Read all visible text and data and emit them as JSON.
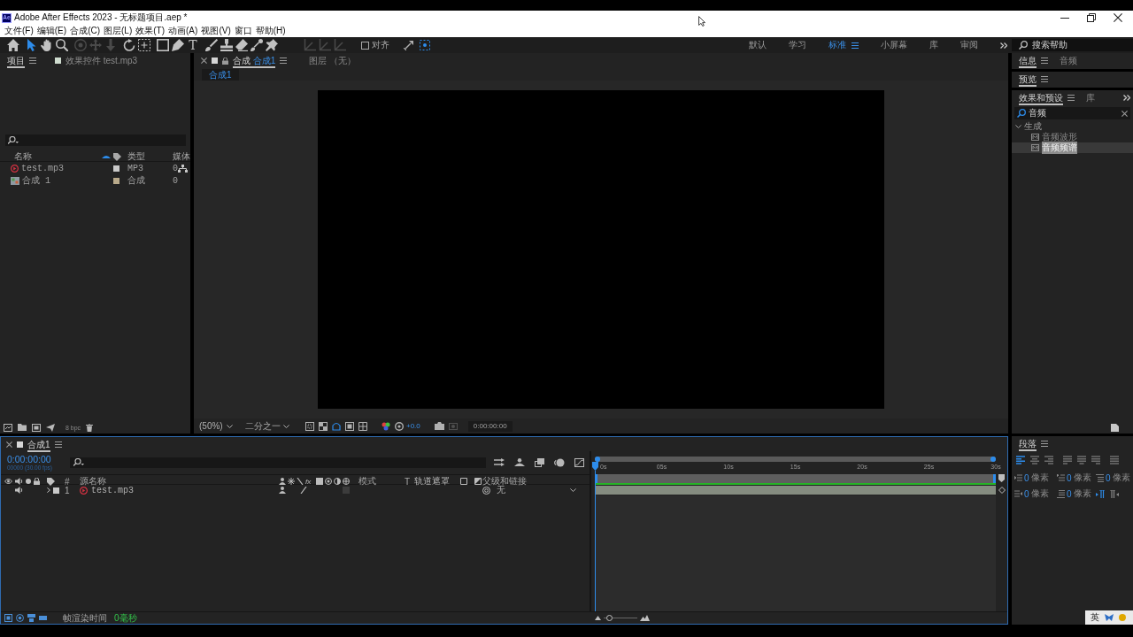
{
  "title_bar": {
    "logo": "Ae",
    "title": "Adobe After Effects 2023 - 无标题项目.aep *"
  },
  "menu_bar": [
    "文件(F)",
    "编辑(E)",
    "合成(C)",
    "图层(L)",
    "效果(T)",
    "动画(A)",
    "视图(V)",
    "窗口",
    "帮助(H)"
  ],
  "toolbar": {
    "tool_groups": [
      {
        "tools": [
          {
            "kind": "home",
            "selected": false,
            "disabled": false
          }
        ]
      },
      {
        "tools": [
          {
            "kind": "selection",
            "selected": true,
            "disabled": false
          },
          {
            "kind": "hand",
            "selected": false,
            "disabled": false
          },
          {
            "kind": "zoom",
            "selected": false,
            "disabled": false
          }
        ]
      },
      {
        "tools": [
          {
            "kind": "orbit",
            "selected": false,
            "disabled": true
          },
          {
            "kind": "pan",
            "selected": false,
            "disabled": true
          },
          {
            "kind": "dolly",
            "selected": false,
            "disabled": true
          }
        ]
      },
      {
        "tools": [
          {
            "kind": "rotate",
            "selected": false,
            "disabled": false
          },
          {
            "kind": "anchor",
            "selected": false,
            "disabled": false
          }
        ]
      },
      {
        "tools": [
          {
            "kind": "rectangle",
            "selected": false,
            "disabled": false
          },
          {
            "kind": "pen",
            "selected": false,
            "disabled": false
          },
          {
            "kind": "type",
            "glyph": "T",
            "selected": false,
            "disabled": false
          }
        ]
      },
      {
        "tools": [
          {
            "kind": "brush",
            "selected": false,
            "disabled": false
          },
          {
            "kind": "stamp",
            "selected": false,
            "disabled": false
          },
          {
            "kind": "eraser",
            "selected": false,
            "disabled": false
          },
          {
            "kind": "roto",
            "selected": false,
            "disabled": false
          },
          {
            "kind": "pin",
            "selected": false,
            "disabled": false
          }
        ]
      },
      {
        "tools": [
          {
            "kind": "axis",
            "selected": false,
            "disabled": true
          },
          {
            "kind": "axis",
            "selected": false,
            "disabled": true
          },
          {
            "kind": "axis",
            "selected": false,
            "disabled": true
          }
        ]
      }
    ],
    "snapping": {
      "label": "对齐",
      "checked": false
    },
    "workspaces": [
      {
        "label": "默认",
        "selected": false
      },
      {
        "label": "学习",
        "selected": false
      },
      {
        "label": "标准",
        "selected": true
      },
      {
        "label": "小屏幕",
        "selected": false
      },
      {
        "label": "库",
        "selected": false
      },
      {
        "label": "审阅",
        "selected": false
      }
    ],
    "help_search": {
      "placeholder": "搜索帮助"
    }
  },
  "project_panel": {
    "tabs": [
      {
        "kind": "panel",
        "label": "项目",
        "selected": true
      },
      {
        "kind": "effect_controls",
        "label": "效果控件 test.mp3",
        "selected": false
      }
    ],
    "columns": [
      "名称",
      "类型",
      "媒体"
    ],
    "items": [
      {
        "kind": "audio",
        "name": "test.mp3",
        "color": "#c9c9c9",
        "type": "MP3",
        "column_3": "0"
      },
      {
        "kind": "composition",
        "name": "合成 1",
        "color": "#b8a98a",
        "type": "合成",
        "column_3": "0"
      }
    ],
    "bit_depth": "8 bpc"
  },
  "composition_panel": {
    "tabs": [
      {
        "kind": "composition",
        "label": "合成",
        "name": "合成1",
        "selected": true
      },
      {
        "kind": "layer",
        "label": "图层 （无）",
        "selected": false
      }
    ],
    "breadcrumb": "合成1",
    "viewer_controls": {
      "magnification": "(50%)",
      "resolution": "二分之一",
      "exposure": "+0.0",
      "timecode": "0:00:00:00"
    }
  },
  "info_panel": {
    "tabs": [
      {
        "label": "信息",
        "selected": true
      },
      {
        "label": "音频",
        "selected": false
      }
    ]
  },
  "preview_panel": {
    "tabs": [
      {
        "label": "预览",
        "selected": true
      }
    ]
  },
  "effects_panel": {
    "tabs": [
      {
        "label": "效果和预设",
        "selected": true
      },
      {
        "label": "库",
        "selected": false
      }
    ],
    "search": {
      "value": "音频"
    },
    "tree": [
      {
        "label": "生成",
        "expanded": true,
        "children": [
          {
            "label": "音频波形",
            "selected": false
          },
          {
            "label": "音频频谱",
            "selected": true
          }
        ]
      }
    ]
  },
  "timeline": {
    "tabs": [
      {
        "label": "合成1",
        "selected": true
      }
    ],
    "timecode": "0:00:00:00",
    "frame_info": "00000 (30.00 fps)",
    "columns": {
      "number": "#",
      "source_name": "源名称",
      "switches": "fx",
      "mode": "模式",
      "t": "T",
      "track_matte": "轨道遮罩",
      "parent": "父级和链接"
    },
    "ruler": [
      "0s",
      "05s",
      "10s",
      "15s",
      "20s",
      "25s",
      "30s"
    ],
    "layers": [
      {
        "number": "1",
        "kind": "audio",
        "name": "test.mp3",
        "color": "#c9c9c9",
        "audio_on": true,
        "expanded": false,
        "parent": "无"
      }
    ],
    "render_time": {
      "label": "帧渲染时间",
      "value": "0毫秒"
    },
    "zoom_slider": {
      "level": 0.1
    }
  },
  "paragraph_panel": {
    "tabs": [
      {
        "label": "段落",
        "selected": true
      }
    ],
    "align_buttons": [
      {
        "kind": "left",
        "selected": true
      },
      {
        "kind": "center",
        "selected": false
      },
      {
        "kind": "right",
        "selected": false
      },
      {
        "kind": "justify_left",
        "selected": false
      },
      {
        "kind": "justify_center",
        "selected": false
      },
      {
        "kind": "justify_right",
        "selected": false
      },
      {
        "kind": "justify_all",
        "selected": false
      }
    ],
    "indents": [
      {
        "kind": "left",
        "value": "0",
        "unit": "像素"
      },
      {
        "kind": "first_line",
        "value": "0",
        "unit": "像素"
      },
      {
        "kind": "before",
        "value": "0",
        "unit": "像素"
      },
      {
        "kind": "right",
        "value": "0",
        "unit": "像素"
      },
      {
        "kind": "after",
        "value": "0",
        "unit": "像素"
      }
    ],
    "directions": [
      {
        "kind": "ltr",
        "selected": true
      },
      {
        "kind": "rtl",
        "selected": false
      }
    ]
  },
  "ime": {
    "label": "英"
  }
}
